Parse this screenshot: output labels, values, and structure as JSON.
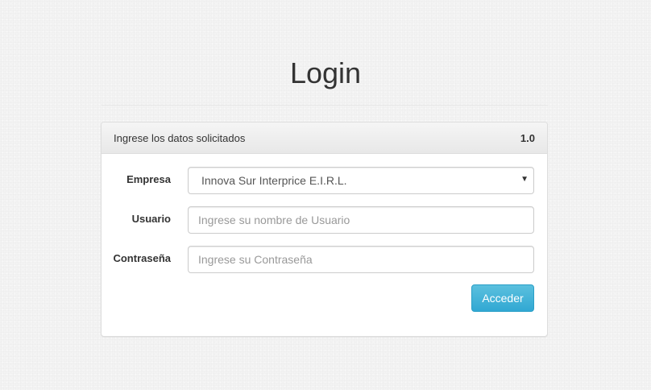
{
  "page": {
    "title": "Login"
  },
  "panel": {
    "heading": "Ingrese los datos solicitados",
    "version": "1.0"
  },
  "form": {
    "empresa": {
      "label": "Empresa",
      "selected": "Innova Sur Interprice E.I.R.L.",
      "caret_icon": "caret-down-icon"
    },
    "usuario": {
      "label": "Usuario",
      "value": "",
      "placeholder": "Ingrese su nombre de Usuario"
    },
    "contrasena": {
      "label": "Contraseña",
      "value": "",
      "placeholder": "Ingrese su Contraseña"
    },
    "submit_label": "Acceder"
  },
  "colors": {
    "primary_button": "#5bc0de",
    "background": "#f3f3f3"
  }
}
